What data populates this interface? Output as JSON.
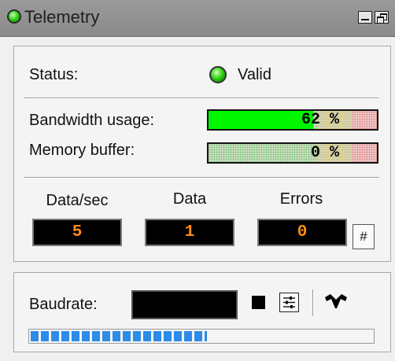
{
  "window": {
    "title": "Telemetry",
    "status_icon": "green-led-icon",
    "buttons": [
      "minimize-icon",
      "restore-icon"
    ]
  },
  "status": {
    "label": "Status:",
    "value": "Valid",
    "indicator_color": "#33d316"
  },
  "bandwidth": {
    "label": "Bandwidth usage:",
    "percent_text": "62 %",
    "level": 0.62,
    "fill_color": "#00f700"
  },
  "memory": {
    "label": "Memory buffer:",
    "percent_text": "0 %",
    "level": 0.0
  },
  "counters": [
    {
      "label": "Data/sec",
      "value": "5"
    },
    {
      "label": "Data",
      "value": "1"
    },
    {
      "label": "Errors",
      "value": "0"
    }
  ],
  "reset_button": "#",
  "baudrate": {
    "label": "Baudrate:",
    "value": "",
    "progress": 0.52,
    "progress_color": "#2d8ce8"
  },
  "icons": {
    "stop": "stop-icon",
    "settings": "settings-icon",
    "signal": "waveform-icon"
  },
  "colors": {
    "lcd_text": "#ff8c1a",
    "titlebar": "#8e8e8e"
  }
}
